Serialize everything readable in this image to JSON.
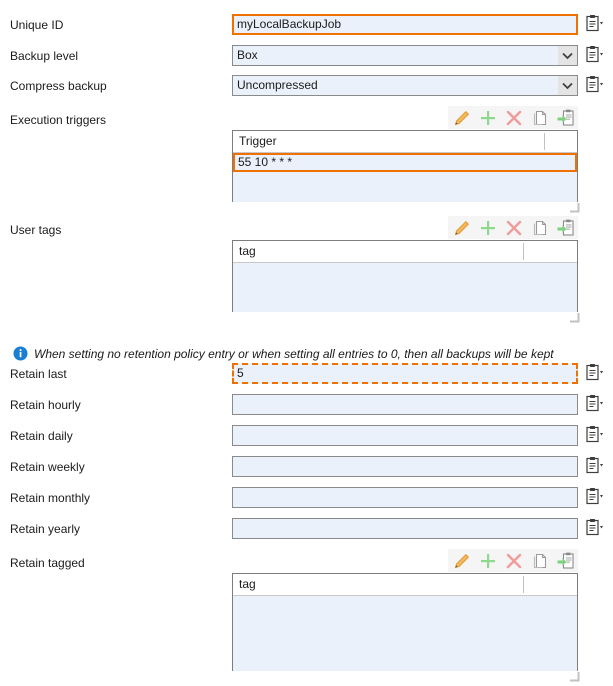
{
  "form": {
    "rows": [
      {
        "label": "Unique ID",
        "type": "text",
        "value": "myLocalBackupJob",
        "state": "focused-solid"
      },
      {
        "label": "Backup level",
        "type": "combo",
        "value": "Box"
      },
      {
        "label": "Compress backup",
        "type": "combo",
        "value": "Uncompressed"
      },
      {
        "label": "Execution triggers",
        "type": "grid"
      },
      {
        "label": "User tags",
        "type": "grid"
      },
      {
        "label": "Retain last",
        "type": "text",
        "value": "5",
        "state": "focused-dashed"
      },
      {
        "label": "Retain hourly",
        "type": "text",
        "value": ""
      },
      {
        "label": "Retain daily",
        "type": "text",
        "value": ""
      },
      {
        "label": "Retain weekly",
        "type": "text",
        "value": ""
      },
      {
        "label": "Retain monthly",
        "type": "text",
        "value": ""
      },
      {
        "label": "Retain yearly",
        "type": "text",
        "value": ""
      },
      {
        "label": "Retain tagged",
        "type": "grid"
      }
    ]
  },
  "labels": {
    "unique_id": "Unique ID",
    "backup_level": "Backup level",
    "compress_backup": "Compress backup",
    "execution_triggers": "Execution triggers",
    "user_tags": "User tags",
    "retain_last": "Retain last",
    "retain_hourly": "Retain hourly",
    "retain_daily": "Retain daily",
    "retain_weekly": "Retain weekly",
    "retain_monthly": "Retain monthly",
    "retain_yearly": "Retain yearly",
    "retain_tagged": "Retain tagged"
  },
  "values": {
    "unique_id": "myLocalBackupJob",
    "backup_level": "Box",
    "compress_backup": "Uncompressed",
    "retain_last": "5",
    "retain_hourly": "",
    "retain_daily": "",
    "retain_weekly": "",
    "retain_monthly": "",
    "retain_yearly": ""
  },
  "triggers_grid": {
    "column_header": "Trigger",
    "rows": [
      {
        "trigger": "55 10 * * *",
        "selected": true
      }
    ]
  },
  "user_tags_grid": {
    "column_header": "tag",
    "rows": []
  },
  "retain_tagged_grid": {
    "column_header": "tag",
    "rows": []
  },
  "toolbar": {
    "edit_label": "Edit",
    "add_label": "Add",
    "delete_label": "Delete",
    "copy_label": "Copy",
    "paste_label": "Paste",
    "icons": [
      "pencil-icon",
      "plus-icon",
      "cross-icon",
      "copy-icon",
      "paste-icon"
    ]
  },
  "info_banner": {
    "icon": "info-icon",
    "text": "When setting no retention policy entry or when setting all entries to 0, then all backups will be kept"
  },
  "colors": {
    "focus_orange": "#f07000",
    "field_background": "#eaf1fb",
    "field_border": "#8a8a8a",
    "pencil": "#f0a030",
    "plus": "#8fd98f",
    "cross": "#f09b9b",
    "paste_arrow": "#7fd07f",
    "info_blue": "#1a7fd4",
    "grid_border": "#7d7d7d",
    "toolbar_background": "#f5f5f5"
  }
}
